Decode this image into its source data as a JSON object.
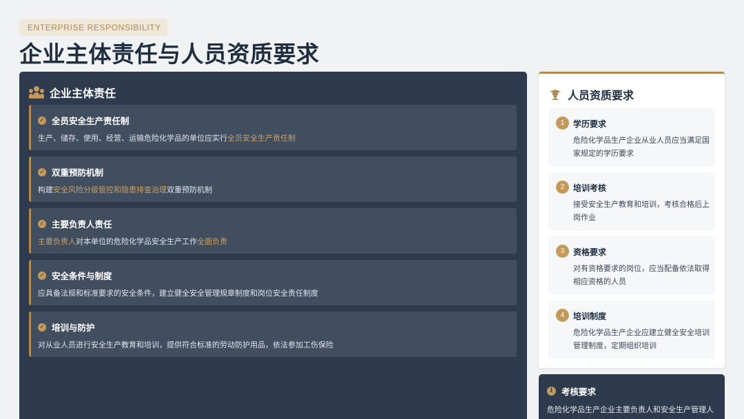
{
  "header": {
    "tag": "ENTERPRISE RESPONSIBILITY",
    "title": "企业主体责任与人员资质要求"
  },
  "left_panel": {
    "title": "企业主体责任",
    "icon": "users-icon",
    "cards": [
      {
        "title": "全员安全生产责任制",
        "desc": [
          {
            "text": "生产、储存、使用、经营、运输危险化学品的单位应实行"
          },
          {
            "text": "全员安全生产责任制"
          }
        ]
      },
      {
        "title": "双重预防机制",
        "desc": [
          {
            "text": "构建"
          },
          {
            "text": "安全风险分级管控和隐患排查治理"
          },
          {
            "text": "双重预防机制"
          }
        ]
      },
      {
        "title": "主要负责人责任",
        "desc": [
          {
            "text": "主要负责人"
          },
          {
            "text": "对本单位的危险化学品安全生产工作"
          },
          {
            "text": "全面负责"
          }
        ]
      },
      {
        "title": "安全条件与制度",
        "desc": [
          {
            "text": "应具备法规和标准要求的安全条件，建立健全安全管理规章制度和岗位安全责任制度"
          }
        ]
      },
      {
        "title": "培训与防护",
        "desc": [
          {
            "text": "对从业人员进行安全生产教育和培训，提供符合标准的劳动防护用品，依法参加工伤保险"
          }
        ]
      }
    ]
  },
  "right_panel": {
    "title": "人员资质要求",
    "icon": "graduate-icon",
    "items": [
      {
        "num": "1",
        "title": "学历要求",
        "desc": "危险化学品生产企业从业人员应当满足国家规定的学历要求"
      },
      {
        "num": "2",
        "title": "培训考核",
        "desc": "接受安全生产教育和培训，考核合格后上岗作业"
      },
      {
        "num": "3",
        "title": "资格要求",
        "desc": "对有资格要求的岗位，应当配备依法取得相应资格的人员"
      },
      {
        "num": "4",
        "title": "培训制度",
        "desc": "危险化学品生产企业应建立健全安全培训管理制度，定期组织培训"
      }
    ]
  },
  "assessment": {
    "icon": "info-icon",
    "title": "考核要求",
    "text": "危险化学品生产企业主要负责人和安全生产管理人员应具备相应的安全生产知识和管理能力，并经应"
  },
  "colors": {
    "accent": "#b08a4e",
    "panel": "#2e3b4e",
    "card": "#414e60"
  }
}
